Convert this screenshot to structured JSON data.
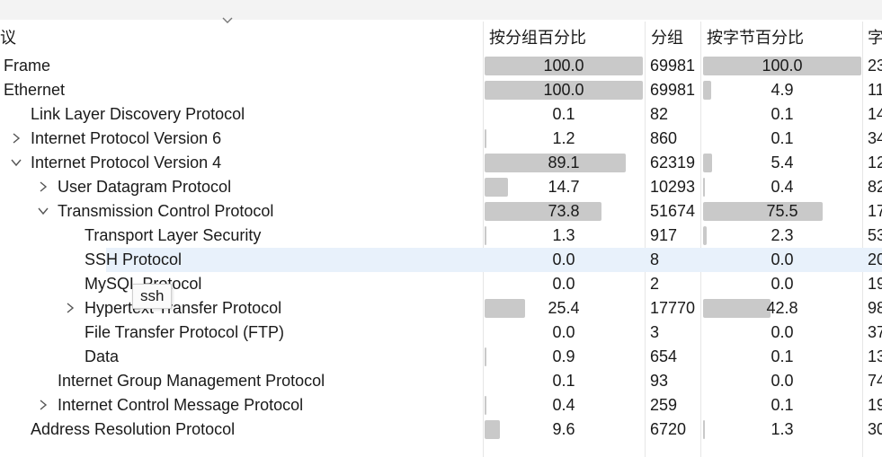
{
  "columns": {
    "protocol": "议",
    "pct_packets": "按分组百分比",
    "packets": "分组",
    "pct_bytes": "按字节百分比",
    "bytes": "字"
  },
  "rows": [
    {
      "name": "Frame",
      "expander": "none",
      "pct_packets": "100.0",
      "packets": "69981",
      "pct_bytes": "100.0",
      "bytes": "23",
      "selected": false
    },
    {
      "name": "Ethernet",
      "expander": "expanded",
      "pct_packets": "100.0",
      "packets": "69981",
      "pct_bytes": "4.9",
      "bytes": "11",
      "selected": false
    },
    {
      "name": "Link Layer Discovery Protocol",
      "expander": "none",
      "pct_packets": "0.1",
      "packets": "82",
      "pct_bytes": "0.1",
      "bytes": "14",
      "selected": false
    },
    {
      "name": "Internet Protocol Version 6",
      "expander": "collapsed",
      "pct_packets": "1.2",
      "packets": "860",
      "pct_bytes": "0.1",
      "bytes": "34",
      "selected": false
    },
    {
      "name": "Internet Protocol Version 4",
      "expander": "expanded",
      "pct_packets": "89.1",
      "packets": "62319",
      "pct_bytes": "5.4",
      "bytes": "12",
      "selected": false
    },
    {
      "name": "User Datagram Protocol",
      "expander": "collapsed",
      "pct_packets": "14.7",
      "packets": "10293",
      "pct_bytes": "0.4",
      "bytes": "82",
      "selected": false
    },
    {
      "name": "Transmission Control Protocol",
      "expander": "expanded",
      "pct_packets": "73.8",
      "packets": "51674",
      "pct_bytes": "75.5",
      "bytes": "17",
      "selected": false
    },
    {
      "name": "Transport Layer Security",
      "expander": "none",
      "pct_packets": "1.3",
      "packets": "917",
      "pct_bytes": "2.3",
      "bytes": "53",
      "selected": false
    },
    {
      "name": "SSH Protocol",
      "expander": "none",
      "pct_packets": "0.0",
      "packets": "8",
      "pct_bytes": "0.0",
      "bytes": "20",
      "selected": true
    },
    {
      "name": "MySQL Protocol",
      "expander": "none",
      "pct_packets": "0.0",
      "packets": "2",
      "pct_bytes": "0.0",
      "bytes": "19",
      "selected": false
    },
    {
      "name": "Hypertext Transfer Protocol",
      "expander": "collapsed",
      "pct_packets": "25.4",
      "packets": "17770",
      "pct_bytes": "42.8",
      "bytes": "98",
      "selected": false
    },
    {
      "name": "File Transfer Protocol (FTP)",
      "expander": "none",
      "pct_packets": "0.0",
      "packets": "3",
      "pct_bytes": "0.0",
      "bytes": "37",
      "selected": false
    },
    {
      "name": "Data",
      "expander": "none",
      "pct_packets": "0.9",
      "packets": "654",
      "pct_bytes": "0.1",
      "bytes": "13",
      "selected": false
    },
    {
      "name": "Internet Group Management Protocol",
      "expander": "none",
      "pct_packets": "0.1",
      "packets": "93",
      "pct_bytes": "0.0",
      "bytes": "74",
      "selected": false
    },
    {
      "name": "Internet Control Message Protocol",
      "expander": "collapsed",
      "pct_packets": "0.4",
      "packets": "259",
      "pct_bytes": "0.1",
      "bytes": "19",
      "selected": false
    },
    {
      "name": "Address Resolution Protocol",
      "expander": "none",
      "pct_packets": "9.6",
      "packets": "6720",
      "pct_bytes": "1.3",
      "bytes": "30",
      "selected": false
    }
  ],
  "tooltip": {
    "text": "ssh"
  },
  "colors": {
    "bar": "#c9c9c9",
    "selected_row": "#e8f1fb",
    "chevron": "#555555"
  }
}
